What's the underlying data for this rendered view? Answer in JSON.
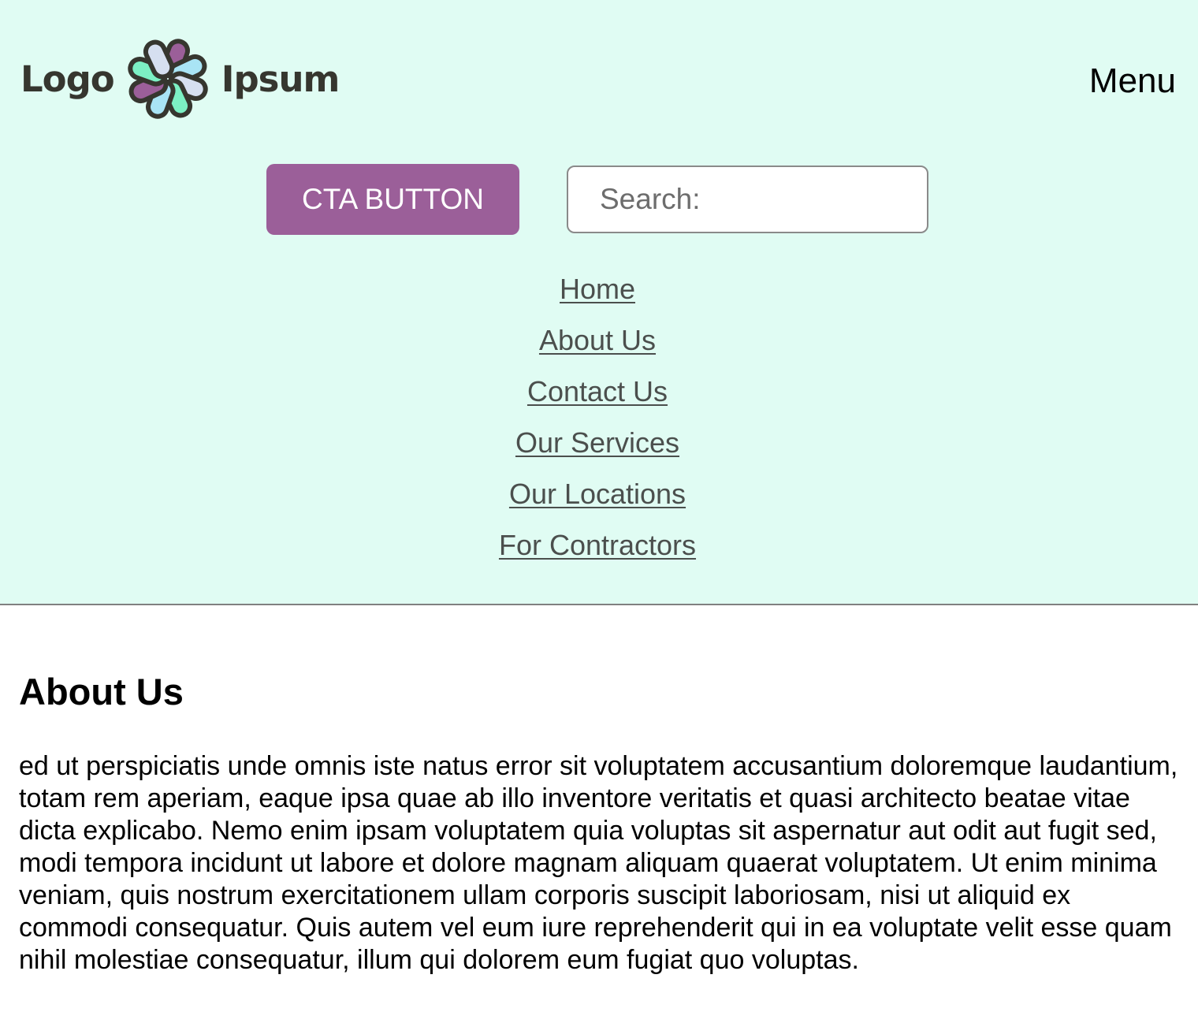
{
  "header": {
    "logo": {
      "text_left": "Logo",
      "text_right": "Ipsum",
      "icon": "flower-pinwheel-logo-icon",
      "colors": [
        "#9b5f99",
        "#7cf0c4",
        "#a9e4f5",
        "#d6dff0",
        "#36362f"
      ]
    },
    "menu_label": "Menu",
    "cta_label": "CTA BUTTON",
    "search": {
      "placeholder": "Search:",
      "value": ""
    },
    "nav": [
      {
        "label": "Home"
      },
      {
        "label": "About Us"
      },
      {
        "label": "Contact Us"
      },
      {
        "label": "Our Services"
      },
      {
        "label": "Our Locations"
      },
      {
        "label": "For Contractors"
      }
    ]
  },
  "main": {
    "heading": "About Us",
    "paragraph": "ed ut perspiciatis unde omnis iste natus error sit voluptatem accusantium doloremque laudantium, totam rem aperiam, eaque ipsa quae ab illo inventore veritatis et quasi architecto beatae vitae dicta explicabo. Nemo enim ipsam voluptatem quia voluptas sit aspernatur aut odit aut fugit sed, modi tempora incidunt ut labore et dolore magnam aliquam quaerat voluptatem. Ut enim minima veniam, quis nostrum exercitationem ullam corporis suscipit laboriosam, nisi ut aliquid ex commodi consequatur. Quis autem vel eum iure reprehenderit qui in ea voluptate velit esse quam nihil molestiae consequatur, illum qui dolorem eum fugiat quo voluptas."
  },
  "colors": {
    "header_bg": "#e0fcf3",
    "cta_bg": "#9b5f99",
    "nav_link": "#4b4f4d",
    "divider": "#808080"
  }
}
